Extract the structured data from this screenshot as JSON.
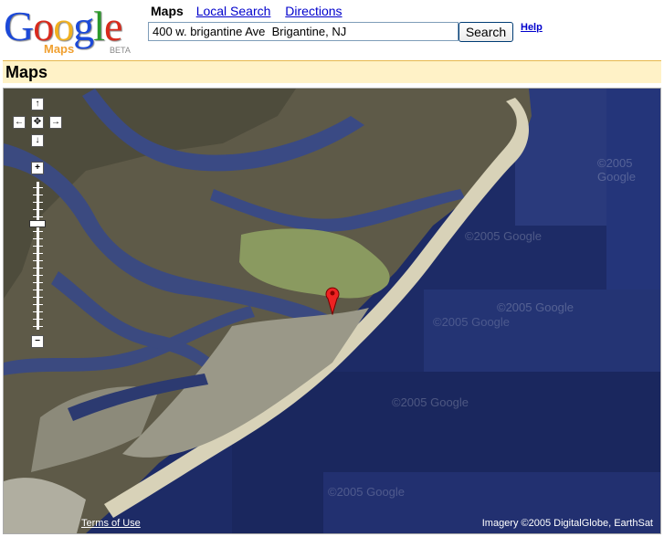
{
  "logo": {
    "word": [
      "G",
      "o",
      "o",
      "g",
      "l",
      "e"
    ],
    "colors": [
      "#1c49d8",
      "#d82a1c",
      "#f0b020",
      "#1c49d8",
      "#2b9a2b",
      "#d82a1c"
    ],
    "sub": "Maps",
    "beta": "BETA"
  },
  "nav": {
    "current": "Maps",
    "links": [
      "Local Search",
      "Directions"
    ]
  },
  "search": {
    "value": "400 w. brigantine Ave  Brigantine, NJ",
    "button": "Search",
    "help": "Help"
  },
  "page_title": "Maps",
  "map": {
    "terms": "Terms of Use",
    "imagery": "Imagery ©2005 DigitalGlobe, EarthSat",
    "watermarks": [
      "©2005 Google",
      "©2005 Google",
      "©2005 Google",
      "©2005 Google",
      "©2005 Google",
      "©2005 Google"
    ],
    "pan_icons": [
      "↑",
      "←",
      "✥",
      "→",
      "↓"
    ],
    "zoom": {
      "plus": "+",
      "minus": "−"
    }
  }
}
